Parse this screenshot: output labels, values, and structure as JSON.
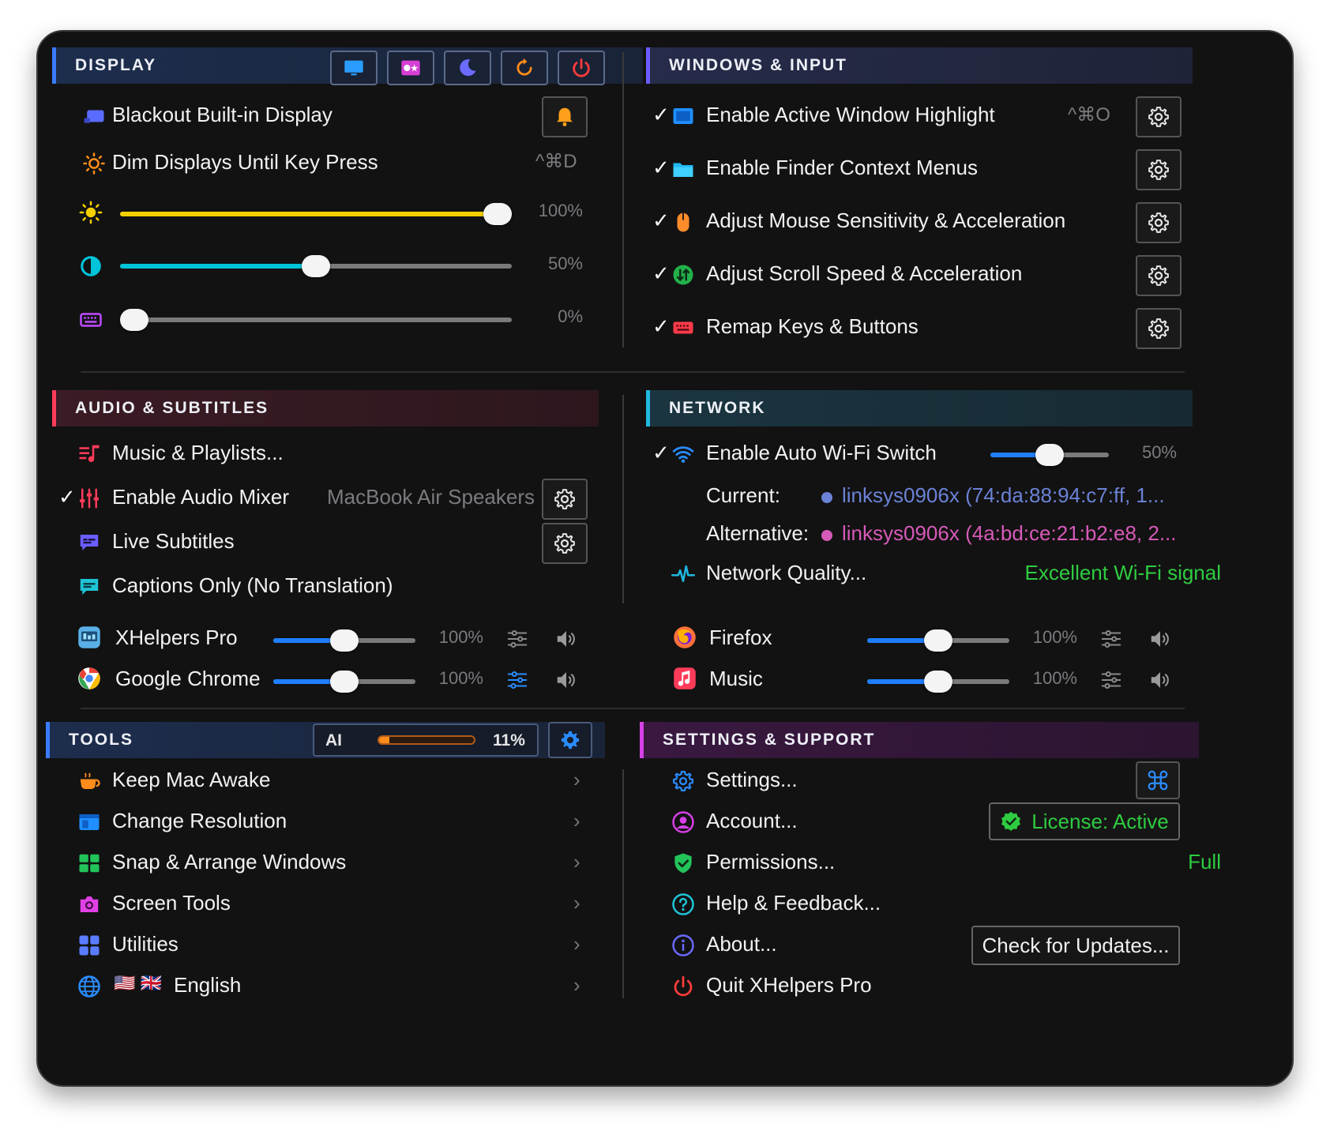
{
  "display": {
    "title": "DISPLAY",
    "toolbar_icons": [
      "monitor-icon",
      "color-filter-icon",
      "moon-icon",
      "refresh-icon",
      "power-icon"
    ],
    "blackout_label": "Blackout Built-in Display",
    "dim_label": "Dim Displays Until Key Press",
    "dim_shortcut": "^⌘D",
    "brightness": {
      "value": 1.0,
      "label": "100%",
      "color": "#f5d000"
    },
    "contrast": {
      "value": 0.5,
      "label": "50%",
      "color": "#00c4d9"
    },
    "keyboard_backlight": {
      "value": 0.0,
      "label": "0%"
    }
  },
  "windows_input": {
    "title": "WINDOWS & INPUT",
    "items": [
      {
        "label": "Enable Active Window Highlight",
        "shortcut": "^⌘O",
        "checked": true
      },
      {
        "label": "Enable Finder Context Menus",
        "checked": true
      },
      {
        "label": "Adjust Mouse Sensitivity & Acceleration",
        "checked": true
      },
      {
        "label": "Adjust Scroll Speed & Acceleration",
        "checked": true
      },
      {
        "label": "Remap Keys & Buttons",
        "checked": true
      }
    ]
  },
  "audio": {
    "title": "AUDIO & SUBTITLES",
    "music_label": "Music & Playlists...",
    "mixer_label": "Enable Audio Mixer",
    "mixer_device": "MacBook Air Speakers",
    "subtitles_label": "Live Subtitles",
    "captions_label": "Captions Only (No Translation)",
    "apps": [
      {
        "name": "XHelpers Pro",
        "volume": 1.0,
        "label": "100%"
      },
      {
        "name": "Google Chrome",
        "volume": 1.0,
        "label": "100%"
      }
    ]
  },
  "network": {
    "title": "NETWORK",
    "wifi_label": "Enable Auto Wi-Fi Switch",
    "wifi_threshold": {
      "value": 0.5,
      "label": "50%"
    },
    "current_label": "Current:",
    "current_value": "linksys0906x (74:da:88:94:c7:ff, 1...",
    "current_color": "#6b82d6",
    "alternative_label": "Alternative:",
    "alternative_value": "linksys0906x (4a:bd:ce:21:b2:e8, 2...",
    "alternative_color": "#d65ab8",
    "quality_label": "Network Quality...",
    "quality_value": "Excellent Wi-Fi signal",
    "quality_color": "#2ecc40",
    "apps": [
      {
        "name": "Firefox",
        "volume": 1.0,
        "label": "100%"
      },
      {
        "name": "Music",
        "volume": 1.0,
        "label": "100%"
      }
    ]
  },
  "tools": {
    "title": "TOOLS",
    "ai_label": "AI",
    "ai_usage": {
      "value": 0.11,
      "label": "11%"
    },
    "items": [
      {
        "label": "Keep Mac Awake"
      },
      {
        "label": "Change Resolution"
      },
      {
        "label": "Snap & Arrange Windows"
      },
      {
        "label": "Screen Tools"
      },
      {
        "label": "Utilities"
      },
      {
        "label": "English",
        "flags": "🇺🇸 🇬🇧"
      }
    ]
  },
  "settings": {
    "title": "SETTINGS & SUPPORT",
    "settings_label": "Settings...",
    "account_label": "Account...",
    "license_label": "License: Active",
    "permissions_label": "Permissions...",
    "permissions_value": "Full",
    "help_label": "Help & Feedback...",
    "about_label": "About...",
    "updates_label": "Check for Updates...",
    "quit_label": "Quit XHelpers Pro"
  }
}
